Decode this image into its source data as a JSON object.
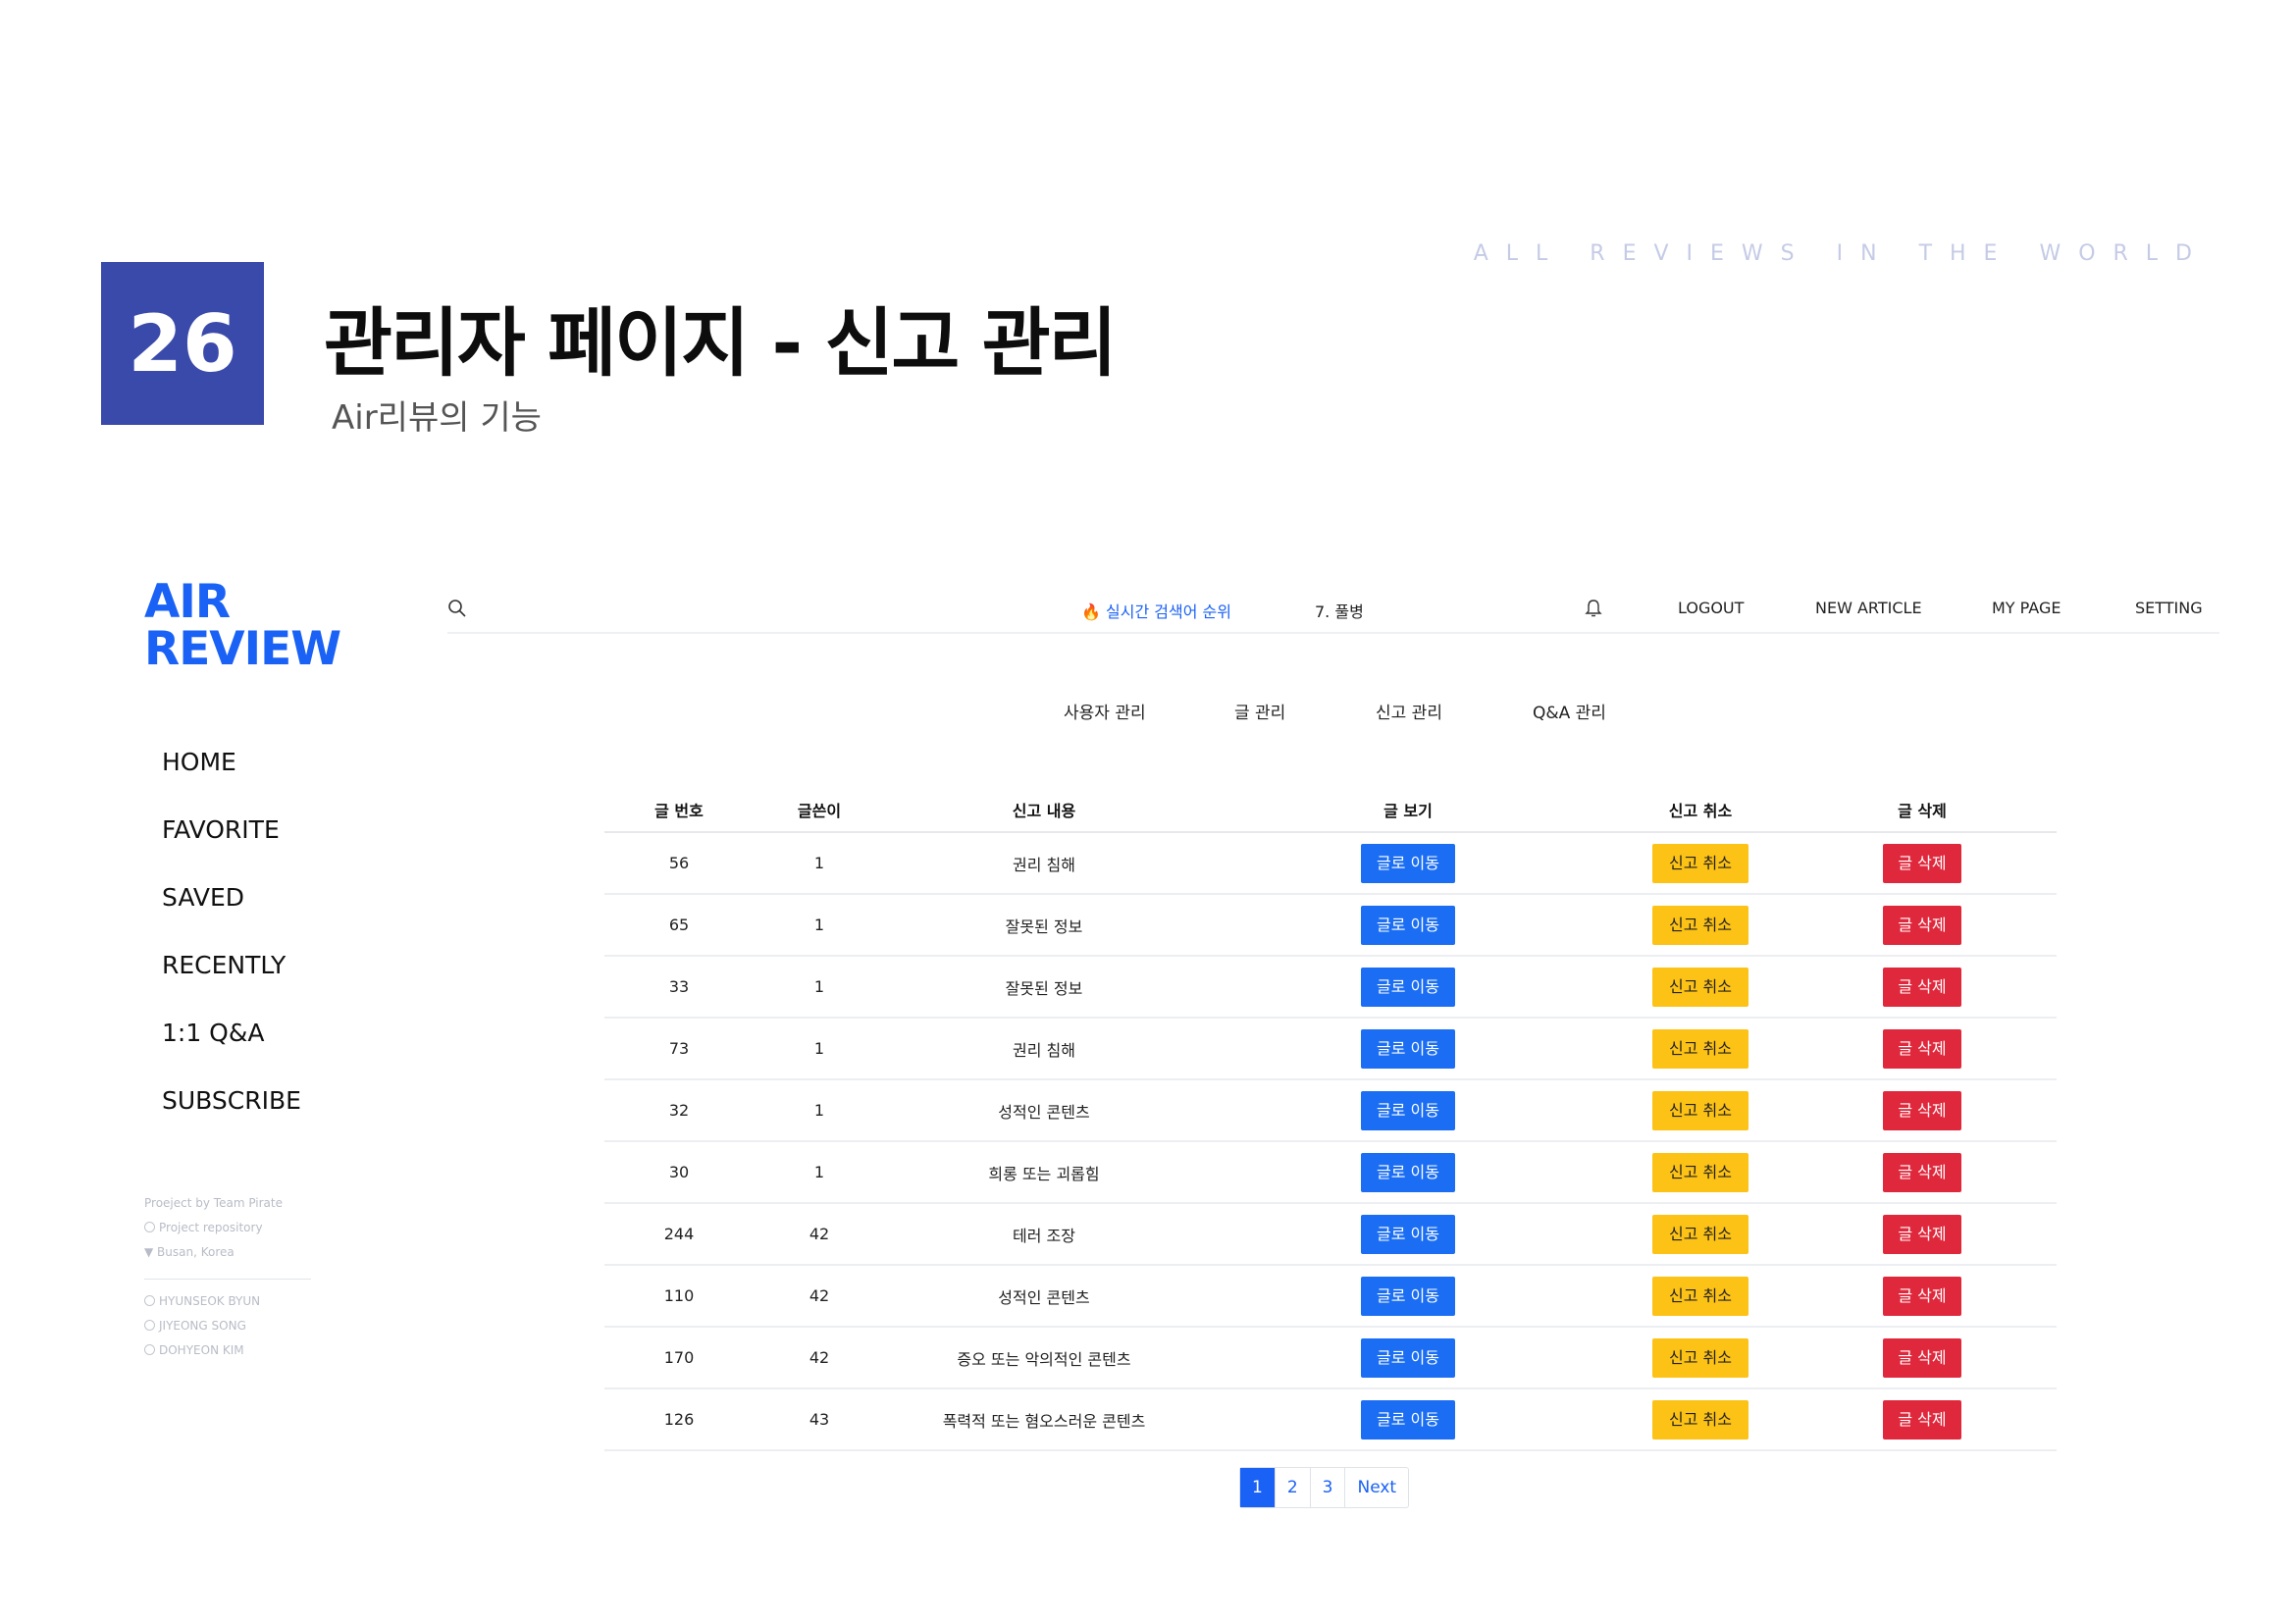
{
  "slide": {
    "number": "26",
    "title": "관리자 페이지 - 신고 관리",
    "subtitle": "Air리뷰의 기능",
    "tagline": "ALL REVIEWS IN THE WORLD"
  },
  "sidebar": {
    "logo_line1": "AIR",
    "logo_line2": "REVIEW",
    "items": [
      {
        "label": "HOME"
      },
      {
        "label": "FAVORITE"
      },
      {
        "label": "SAVED"
      },
      {
        "label": "RECENTLY"
      },
      {
        "label": "1:1 Q&A"
      },
      {
        "label": "SUBSCRIBE"
      }
    ],
    "footer": {
      "project": "Proeject by Team Pirate",
      "repo": "Project repository",
      "location": "Busan, Korea",
      "members": [
        "HYUNSEOK BYUN",
        "JIYEONG SONG",
        "DOHYEON KIM"
      ]
    }
  },
  "topbar": {
    "trending_label": "실시간 검색어 순위",
    "trending_item": "7. 풀병",
    "logout": "LOGOUT",
    "new_article": "NEW ARTICLE",
    "my_page": "MY PAGE",
    "setting": "SETTING"
  },
  "admin_tabs": {
    "users": "사용자 관리",
    "posts": "글 관리",
    "reports": "신고 관리",
    "qna": "Q&A 관리"
  },
  "table": {
    "headers": {
      "post_no": "글 번호",
      "author": "글쓴이",
      "reason": "신고 내용",
      "view": "글 보기",
      "cancel": "신고 취소",
      "delete": "글 삭제"
    },
    "buttons": {
      "view": "글로 이동",
      "cancel": "신고 취소",
      "delete": "글 삭제"
    },
    "rows": [
      {
        "post_no": "56",
        "author": "1",
        "reason": "권리 침해"
      },
      {
        "post_no": "65",
        "author": "1",
        "reason": "잘못된 정보"
      },
      {
        "post_no": "33",
        "author": "1",
        "reason": "잘못된 정보"
      },
      {
        "post_no": "73",
        "author": "1",
        "reason": "권리 침해"
      },
      {
        "post_no": "32",
        "author": "1",
        "reason": "성적인 콘텐츠"
      },
      {
        "post_no": "30",
        "author": "1",
        "reason": "희롱 또는 괴롭힘"
      },
      {
        "post_no": "244",
        "author": "42",
        "reason": "테러 조장"
      },
      {
        "post_no": "110",
        "author": "42",
        "reason": "성적인 콘텐츠"
      },
      {
        "post_no": "170",
        "author": "42",
        "reason": "증오 또는 악의적인 콘텐츠"
      },
      {
        "post_no": "126",
        "author": "43",
        "reason": "폭력적 또는 혐오스러운 콘텐츠"
      }
    ]
  },
  "pagination": {
    "pages": [
      "1",
      "2",
      "3"
    ],
    "next": "Next",
    "current": "1"
  },
  "colors": {
    "brand": "#1a61f5",
    "slide_box": "#3a4aaa",
    "btn_blue": "#1b6ef3",
    "btn_yellow": "#fdc216",
    "btn_red": "#e0283c"
  }
}
